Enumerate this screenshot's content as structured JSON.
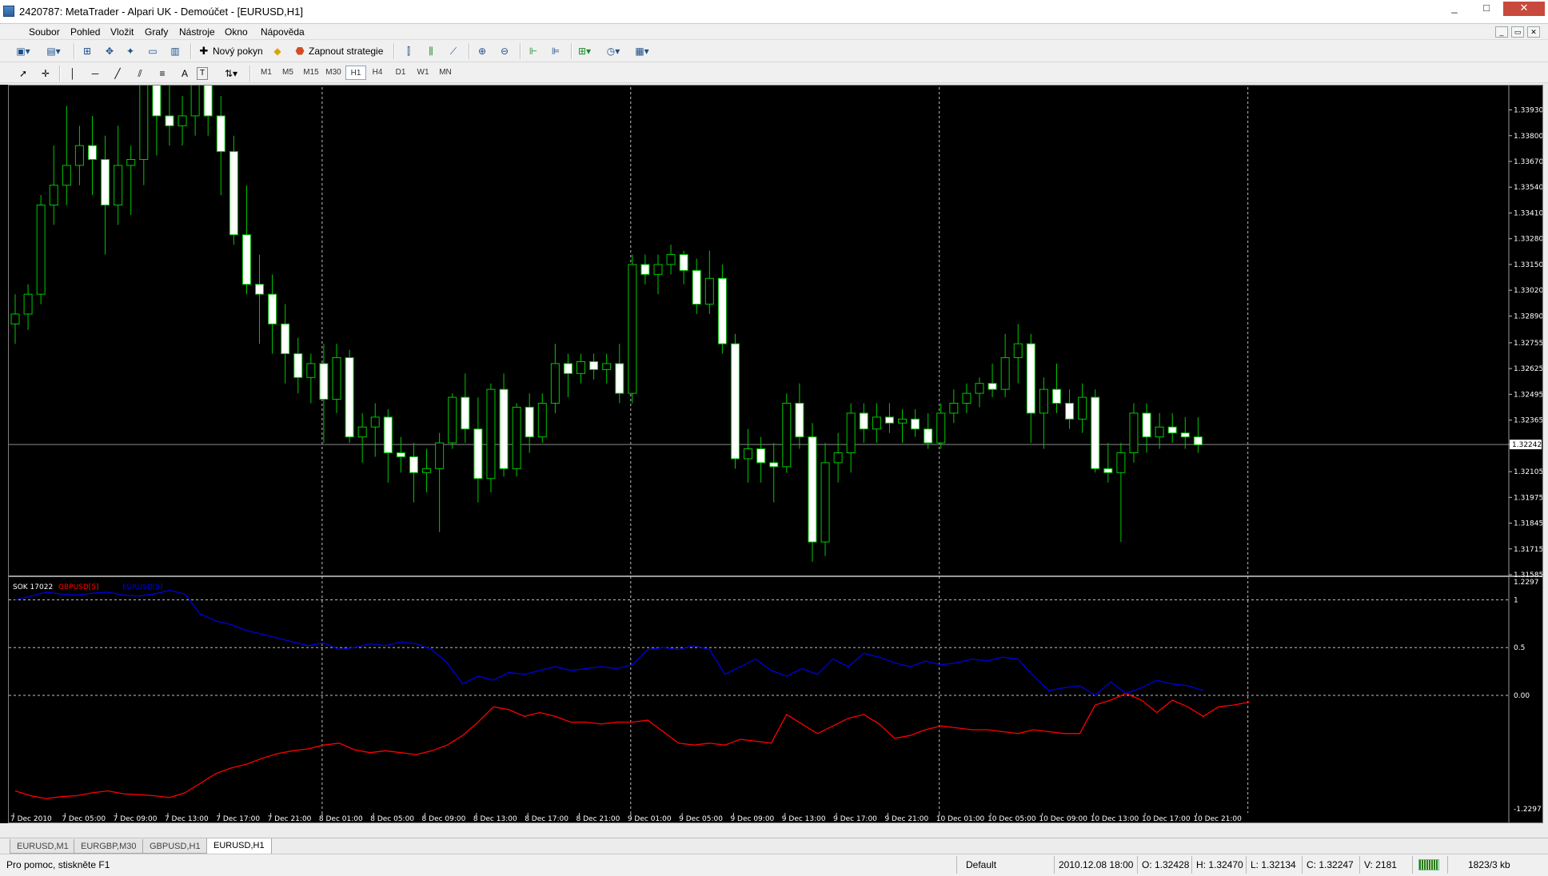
{
  "window": {
    "title": "2420787: MetaTrader - Alpari UK - Demoúčet - [EURUSD,H1]",
    "controls": [
      "_",
      "□",
      "✕"
    ],
    "mdi_controls": [
      "_",
      "▭",
      "✕"
    ]
  },
  "menu": [
    "Soubor",
    "Pohled",
    "Vložit",
    "Grafy",
    "Nástroje",
    "Okno",
    "Nápověda"
  ],
  "toolbar": {
    "new_order": "Nový pokyn",
    "strategy": "Zapnout strategie"
  },
  "timeframes": [
    "M1",
    "M5",
    "M15",
    "M30",
    "H1",
    "H4",
    "D1",
    "W1",
    "MN"
  ],
  "active_timeframe": "H1",
  "drawing_tools": [
    "cursor-arrow",
    "crosshair",
    "vertical-line",
    "horizontal-line",
    "trend-line",
    "fibonacci",
    "channel",
    "A",
    "T",
    "arrows"
  ],
  "chart_data": [
    {
      "type": "candlestick",
      "symbol": "EURUSD",
      "timeframe": "H1",
      "bull_color": "#000000",
      "bear_color": "#ffffff",
      "wick_color": "#00c800",
      "price_axis": [
        "1.33930",
        "1.33800",
        "1.33670",
        "1.33540",
        "1.33410",
        "1.33280",
        "1.33150",
        "1.33020",
        "1.32890",
        "1.32755",
        "1.32625",
        "1.32495",
        "1.32365",
        "1.32242",
        "1.32105",
        "1.31975",
        "1.31845",
        "1.31715",
        "1.31585"
      ],
      "ylim": [
        1.31585,
        1.34045
      ],
      "current_price": "1.32242",
      "x_labels": [
        "7 Dec 2010",
        "7 Dec 05:00",
        "7 Dec 09:00",
        "7 Dec 13:00",
        "7 Dec 17:00",
        "7 Dec 21:00",
        "8 Dec 01:00",
        "8 Dec 05:00",
        "8 Dec 09:00",
        "8 Dec 13:00",
        "8 Dec 17:00",
        "8 Dec 21:00",
        "9 Dec 01:00",
        "9 Dec 05:00",
        "9 Dec 09:00",
        "9 Dec 13:00",
        "9 Dec 17:00",
        "9 Dec 21:00",
        "10 Dec 01:00",
        "10 Dec 05:00",
        "10 Dec 09:00",
        "10 Dec 13:00",
        "10 Dec 17:00",
        "10 Dec 21:00"
      ],
      "ohlc": [
        [
          1.3285,
          1.33,
          1.3275,
          1.329
        ],
        [
          1.329,
          1.3305,
          1.3282,
          1.33
        ],
        [
          1.33,
          1.335,
          1.3295,
          1.3345
        ],
        [
          1.3345,
          1.3375,
          1.3335,
          1.3355
        ],
        [
          1.3355,
          1.3395,
          1.3345,
          1.3365
        ],
        [
          1.3365,
          1.3385,
          1.3355,
          1.3375
        ],
        [
          1.3375,
          1.339,
          1.335,
          1.3368
        ],
        [
          1.3368,
          1.338,
          1.332,
          1.3345
        ],
        [
          1.3345,
          1.3385,
          1.3335,
          1.3365
        ],
        [
          1.3365,
          1.3375,
          1.334,
          1.3368
        ],
        [
          1.3368,
          1.3418,
          1.3355,
          1.341
        ],
        [
          1.341,
          1.3432,
          1.337,
          1.339
        ],
        [
          1.339,
          1.341,
          1.3375,
          1.3385
        ],
        [
          1.3385,
          1.34,
          1.3375,
          1.339
        ],
        [
          1.339,
          1.3425,
          1.338,
          1.342
        ],
        [
          1.342,
          1.343,
          1.338,
          1.339
        ],
        [
          1.339,
          1.34,
          1.335,
          1.3372
        ],
        [
          1.3372,
          1.338,
          1.3325,
          1.333
        ],
        [
          1.333,
          1.3355,
          1.33,
          1.3305
        ],
        [
          1.3305,
          1.332,
          1.3275,
          1.33
        ],
        [
          1.33,
          1.331,
          1.327,
          1.3285
        ],
        [
          1.3285,
          1.3295,
          1.3255,
          1.327
        ],
        [
          1.327,
          1.3278,
          1.325,
          1.3258
        ],
        [
          1.3258,
          1.327,
          1.3245,
          1.3265
        ],
        [
          1.3265,
          1.3275,
          1.3225,
          1.3247
        ],
        [
          1.3247,
          1.3275,
          1.324,
          1.3268
        ],
        [
          1.3268,
          1.3272,
          1.3225,
          1.3228
        ],
        [
          1.3228,
          1.324,
          1.3215,
          1.3233
        ],
        [
          1.3233,
          1.3245,
          1.3218,
          1.3238
        ],
        [
          1.3238,
          1.3242,
          1.3205,
          1.322
        ],
        [
          1.322,
          1.3228,
          1.321,
          1.3218
        ],
        [
          1.3218,
          1.3225,
          1.3195,
          1.321
        ],
        [
          1.321,
          1.3222,
          1.32,
          1.3212
        ],
        [
          1.3212,
          1.323,
          1.318,
          1.3225
        ],
        [
          1.3225,
          1.325,
          1.3222,
          1.3248
        ],
        [
          1.3248,
          1.326,
          1.3225,
          1.3232
        ],
        [
          1.3232,
          1.3248,
          1.3195,
          1.3207
        ],
        [
          1.3207,
          1.3255,
          1.32,
          1.3252
        ],
        [
          1.3252,
          1.326,
          1.3208,
          1.3212
        ],
        [
          1.3212,
          1.3245,
          1.3208,
          1.3243
        ],
        [
          1.3243,
          1.325,
          1.322,
          1.3228
        ],
        [
          1.3228,
          1.325,
          1.3225,
          1.3245
        ],
        [
          1.3245,
          1.3275,
          1.324,
          1.3265
        ],
        [
          1.3265,
          1.327,
          1.3248,
          1.326
        ],
        [
          1.326,
          1.327,
          1.3255,
          1.3266
        ],
        [
          1.3266,
          1.327,
          1.3257,
          1.3262
        ],
        [
          1.3262,
          1.327,
          1.3255,
          1.3265
        ],
        [
          1.3265,
          1.3275,
          1.3245,
          1.325
        ],
        [
          1.325,
          1.332,
          1.3245,
          1.3315
        ],
        [
          1.3315,
          1.332,
          1.3305,
          1.331
        ],
        [
          1.331,
          1.332,
          1.33,
          1.3315
        ],
        [
          1.3315,
          1.3325,
          1.331,
          1.332
        ],
        [
          1.332,
          1.3322,
          1.3305,
          1.3312
        ],
        [
          1.3312,
          1.3318,
          1.329,
          1.3295
        ],
        [
          1.3295,
          1.3322,
          1.329,
          1.3308
        ],
        [
          1.3308,
          1.3315,
          1.327,
          1.3275
        ],
        [
          1.3275,
          1.328,
          1.3212,
          1.3217
        ],
        [
          1.3217,
          1.3232,
          1.3205,
          1.3222
        ],
        [
          1.3222,
          1.3228,
          1.3205,
          1.3215
        ],
        [
          1.3215,
          1.3225,
          1.3195,
          1.3213
        ],
        [
          1.3213,
          1.325,
          1.321,
          1.3245
        ],
        [
          1.3245,
          1.3255,
          1.3222,
          1.3228
        ],
        [
          1.3228,
          1.3235,
          1.3165,
          1.3175
        ],
        [
          1.3175,
          1.3225,
          1.3168,
          1.3215
        ],
        [
          1.3215,
          1.323,
          1.3205,
          1.322
        ],
        [
          1.322,
          1.3245,
          1.321,
          1.324
        ],
        [
          1.324,
          1.3245,
          1.3225,
          1.3232
        ],
        [
          1.3232,
          1.3245,
          1.3225,
          1.3238
        ],
        [
          1.3238,
          1.3245,
          1.323,
          1.3235
        ],
        [
          1.3235,
          1.3242,
          1.3225,
          1.3237
        ],
        [
          1.3237,
          1.3242,
          1.3228,
          1.3232
        ],
        [
          1.3232,
          1.324,
          1.3222,
          1.3225
        ],
        [
          1.3225,
          1.3245,
          1.3222,
          1.324
        ],
        [
          1.324,
          1.3252,
          1.3235,
          1.3245
        ],
        [
          1.3245,
          1.3255,
          1.324,
          1.325
        ],
        [
          1.325,
          1.3258,
          1.3243,
          1.3255
        ],
        [
          1.3255,
          1.3265,
          1.3248,
          1.3252
        ],
        [
          1.3252,
          1.328,
          1.3248,
          1.3268
        ],
        [
          1.3268,
          1.3285,
          1.3255,
          1.3275
        ],
        [
          1.3275,
          1.328,
          1.3225,
          1.324
        ],
        [
          1.324,
          1.3258,
          1.3222,
          1.3252
        ],
        [
          1.3252,
          1.3265,
          1.324,
          1.3245
        ],
        [
          1.3245,
          1.3252,
          1.3232,
          1.3237
        ],
        [
          1.3237,
          1.3255,
          1.323,
          1.3248
        ],
        [
          1.3248,
          1.3252,
          1.321,
          1.3212
        ],
        [
          1.3212,
          1.3225,
          1.3205,
          1.321
        ],
        [
          1.321,
          1.3225,
          1.3175,
          1.322
        ],
        [
          1.322,
          1.3245,
          1.3215,
          1.324
        ],
        [
          1.324,
          1.3245,
          1.322,
          1.3228
        ],
        [
          1.3228,
          1.324,
          1.3222,
          1.3233
        ],
        [
          1.3233,
          1.324,
          1.3225,
          1.323
        ],
        [
          1.323,
          1.3238,
          1.3222,
          1.3228
        ],
        [
          1.3228,
          1.3238,
          1.322,
          1.3224
        ]
      ]
    },
    {
      "type": "line",
      "indicator": "SOK 17022",
      "ylim": [
        -1.2297,
        1.2297
      ],
      "axis_labels": [
        "1.2297",
        "1",
        "0.5",
        "0.00",
        "-1.2297"
      ],
      "series": [
        {
          "name": "GBPUSD[5]",
          "color": "#ff0000",
          "values": [
            -1.0,
            -1.05,
            -1.08,
            -1.06,
            -1.05,
            -1.02,
            -1.0,
            -1.03,
            -1.04,
            -1.05,
            -1.07,
            -1.02,
            -0.92,
            -0.82,
            -0.76,
            -0.72,
            -0.66,
            -0.61,
            -0.58,
            -0.56,
            -0.52,
            -0.5,
            -0.57,
            -0.6,
            -0.58,
            -0.6,
            -0.62,
            -0.58,
            -0.52,
            -0.42,
            -0.28,
            -0.12,
            -0.15,
            -0.22,
            -0.18,
            -0.22,
            -0.28,
            -0.28,
            -0.3,
            -0.28,
            -0.28,
            -0.26,
            -0.38,
            -0.5,
            -0.52,
            -0.5,
            -0.52,
            -0.46,
            -0.48,
            -0.5,
            -0.2,
            -0.3,
            -0.4,
            -0.32,
            -0.24,
            -0.2,
            -0.3,
            -0.45,
            -0.42,
            -0.36,
            -0.32,
            -0.34,
            -0.36,
            -0.36,
            -0.38,
            -0.4,
            -0.36,
            -0.38,
            -0.4,
            -0.4,
            -0.1,
            -0.05,
            0.02,
            -0.05,
            -0.18,
            -0.05,
            -0.12,
            -0.22,
            -0.12,
            -0.1,
            -0.07
          ]
        },
        {
          "name": "EURUSD[5]",
          "color": "#0000e0",
          "values": [
            1.0,
            1.04,
            1.08,
            1.06,
            1.05,
            1.07,
            1.08,
            1.05,
            1.04,
            1.06,
            1.1,
            1.06,
            0.85,
            0.78,
            0.74,
            0.68,
            0.64,
            0.6,
            0.56,
            0.52,
            0.55,
            0.48,
            0.5,
            0.54,
            0.52,
            0.56,
            0.54,
            0.48,
            0.34,
            0.12,
            0.2,
            0.16,
            0.24,
            0.22,
            0.26,
            0.3,
            0.26,
            0.28,
            0.3,
            0.28,
            0.32,
            0.48,
            0.5,
            0.48,
            0.52,
            0.48,
            0.22,
            0.3,
            0.38,
            0.26,
            0.2,
            0.28,
            0.22,
            0.38,
            0.3,
            0.44,
            0.4,
            0.34,
            0.3,
            0.36,
            0.32,
            0.34,
            0.38,
            0.36,
            0.4,
            0.38,
            0.2,
            0.05,
            0.08,
            0.1,
            0.0,
            0.14,
            0.02,
            0.08,
            0.16,
            0.12,
            0.1,
            0.05
          ]
        }
      ]
    }
  ],
  "tabs": [
    "EURUSD,M1",
    "EURGBP,M30",
    "GBPUSD,H1",
    "EURUSD,H1"
  ],
  "active_tab": "EURUSD,H1",
  "status": {
    "help": "Pro pomoc, stiskněte F1",
    "profile": "Default",
    "datetime": "2010.12.08 18:00",
    "open": "O: 1.32428",
    "high": "H: 1.32470",
    "low": "L: 1.32134",
    "close": "C: 1.32247",
    "volume": "V: 2181",
    "traffic": "1823/3 kb"
  },
  "colors": {
    "chart_bg": "#000000",
    "grid": "#c0c0c0",
    "axis_text": "#ffffff",
    "bid_line": "#8a8a8a"
  }
}
